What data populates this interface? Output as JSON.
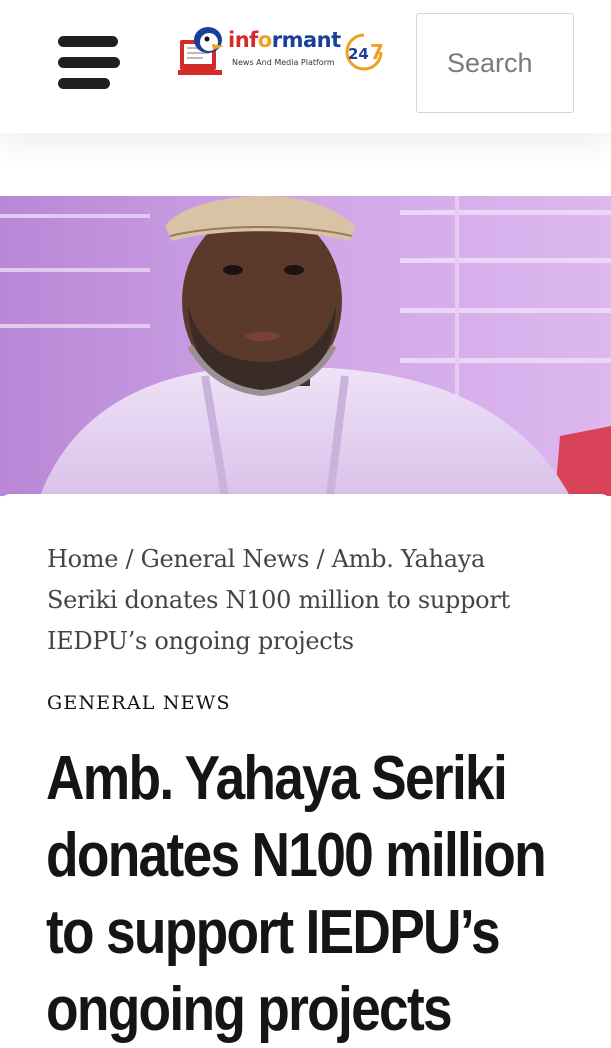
{
  "header": {
    "logo": {
      "word_part1": "inf",
      "word_o": "o",
      "word_part2": "rmant",
      "number": "24",
      "number_7": "7",
      "tagline": "News And Media Platform"
    },
    "search": {
      "placeholder": "Search"
    },
    "colors": {
      "logo_blue": "#1a3f9a",
      "logo_orange": "#f0a020",
      "logo_red": "#d42a2a"
    }
  },
  "hero": {
    "image_description": "portrait photo",
    "background": "#c99ae0"
  },
  "breadcrumb": {
    "home": "Home",
    "sep1": " / ",
    "category": "General News",
    "sep2": " / ",
    "current": "Amb. Yahaya Seriki donates N100 million to support IEDPU’s ongoing projects"
  },
  "article": {
    "category": "GENERAL NEWS",
    "title_lines": [
      "Amb. Yahaya Seriki",
      "donates N100 million",
      "to support IEDPU’s",
      "ongoing projects"
    ]
  }
}
